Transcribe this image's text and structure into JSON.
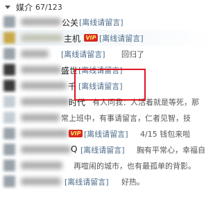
{
  "group": {
    "name": "媒介",
    "count": "67/123"
  },
  "offline_label": "[离线请留言]",
  "rows": [
    {
      "name_tail": "公关",
      "status": "[离线请留言]",
      "sign": ""
    },
    {
      "name_tail": "主机",
      "vip": "VIP",
      "status": "[离线请留言]",
      "sign": ""
    },
    {
      "name_tail": "",
      "status": "[离线请留言]",
      "sign": "回归了"
    },
    {
      "name_tail": "盛世",
      "status": "[离线请留言]",
      "sign": ""
    },
    {
      "name_tail": "千",
      "status": "[离线请留言]",
      "sign": ""
    },
    {
      "name_tail": "时代",
      "status": "",
      "sign": "有人问我：人活着就是等死，那"
    },
    {
      "name_tail": "",
      "status": "",
      "sign": "常上班中，有事请留言，仁者见智，技"
    },
    {
      "name_tail": "",
      "vip": "VIP",
      "status": "[离线请留言]",
      "sign": "4/15 钱包来啦"
    },
    {
      "name_tail": "Q",
      "status": "[离线请留言]",
      "sign": "胸有平常心，幸福自"
    },
    {
      "name_tail": "",
      "status": "",
      "sign": "再喧闹的城市，也有最孤单的背影。"
    },
    {
      "name_tail": "",
      "status": "[离线请留言]",
      "sign": "好热。"
    }
  ]
}
